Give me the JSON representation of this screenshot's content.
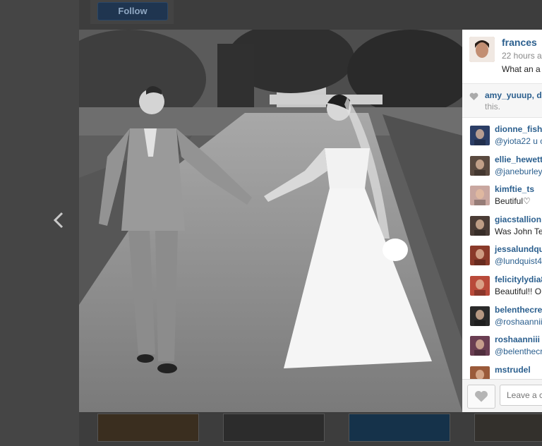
{
  "background": {
    "follow_label": "Follow"
  },
  "post": {
    "author": {
      "username": "frances",
      "time": "22 hours a",
      "caption": "What an a"
    },
    "likes": {
      "names": "amy_yuuup, di",
      "rest": "this."
    },
    "comments": [
      {
        "user": "dionne_fish",
        "text": "@yiota22 u c",
        "mention": true,
        "avatar_color": "#2c3e66"
      },
      {
        "user": "ellie_hewett",
        "text": "@janeburley",
        "mention": true,
        "avatar_color": "#5a4a40"
      },
      {
        "user": "kimftie_ts",
        "text": "Beutiful♡",
        "mention": false,
        "avatar_color": "#c9a7a0"
      },
      {
        "user": "giacstallion",
        "text": "Was John Te",
        "mention": false,
        "avatar_color": "#4a3c36"
      },
      {
        "user": "jessalundqu",
        "text": "@lundquist4",
        "mention": true,
        "avatar_color": "#8a3a2a"
      },
      {
        "user": "felicitylydia8",
        "text": "Beautiful!! O",
        "mention": false,
        "avatar_color": "#b94a3a"
      },
      {
        "user": "belenthecre",
        "text": "@roshaanniii",
        "mention": true,
        "avatar_color": "#2a2a2a"
      },
      {
        "user": "roshaanniii",
        "text": "@belenthecr",
        "mention": true,
        "avatar_color": "#6a3e52"
      },
      {
        "user": "mstrudel",
        "text": "",
        "mention": false,
        "avatar_color": "#9a5a3a"
      }
    ],
    "comment_placeholder": "Leave a c"
  },
  "colors": {
    "link": "#2b5f8e",
    "overlay": "#3d3d3d"
  }
}
